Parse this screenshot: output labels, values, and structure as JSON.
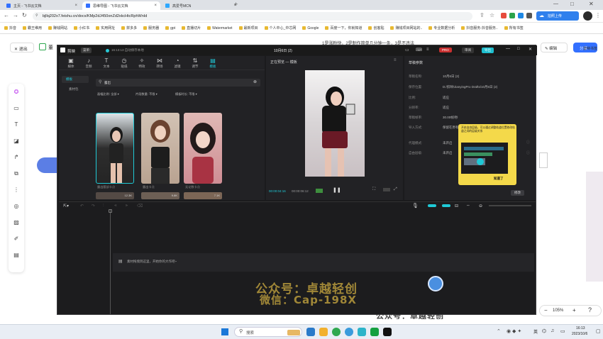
{
  "browser": {
    "tabs": [
      {
        "label": "主页 - 飞书云文档",
        "color": "#3370ff"
      },
      {
        "label": "思维导图 - 飞书云文档",
        "color": "#3370ff"
      },
      {
        "label": "高爱号MCN",
        "color": "#2fa8ff"
      }
    ],
    "url": "bjllq202x7.feishu.cn/docx/KMp2dJ450onZd2xkcHtcRphWnId",
    "bookmarks": [
      "抖音",
      "霸王维用",
      "赚钱网站",
      "小红书",
      "实用网址",
      "拼多多",
      "服务器",
      "gpt",
      "直播切片",
      "Watermarket",
      "最新项目",
      "个人中心_中芯网",
      "Google",
      "百度一下，你就知道",
      "创客贴",
      "赚钱项目网站的..",
      "专业数据分析",
      "抖音服务-抖音服务..",
      "所有书签"
    ]
  },
  "doc": {
    "exit_label": "退出",
    "doc_label": "董",
    "header_text": "1是涨粉快，2是制作简单几分钟一条，3是不违法",
    "edit_label": "编辑",
    "share_label": "分享",
    "zoom": "105%",
    "right_text": "雷特书签",
    "bottom_text": "公众号：卓越轻创"
  },
  "capcut": {
    "app_name": "剪映",
    "menu_label": "菜单",
    "autosave": "16:13:13 自动保存本地",
    "project_title": "10月6日 (2)",
    "pro_label": "PRO",
    "review_label": "审阅",
    "export_label": "导出",
    "toolbar": [
      {
        "label": "媒体",
        "glyph": "▣"
      },
      {
        "label": "音频",
        "glyph": "♪"
      },
      {
        "label": "文本",
        "glyph": "T"
      },
      {
        "label": "贴纸",
        "glyph": "◷"
      },
      {
        "label": "特效",
        "glyph": "✧"
      },
      {
        "label": "转场",
        "glyph": "⋈"
      },
      {
        "label": "滤镜",
        "glyph": "◔"
      },
      {
        "label": "调节",
        "glyph": "⇅"
      },
      {
        "label": "模板",
        "glyph": "▤"
      }
    ],
    "sidebar": [
      "模板",
      "素材包"
    ],
    "search_value": "露出",
    "filters": [
      "画幅比例: 全部",
      "片段数量: 不限",
      "模板时长: 不限"
    ],
    "templates": [
      {
        "caption": "露出腰部卡点",
        "stats": "12.3K"
      },
      {
        "caption": "露出卡点",
        "stats": "9.8K"
      },
      {
        "caption": "无论数卡点",
        "stats": "7.1K"
      }
    ],
    "preview": {
      "header": "正在预览 — 模板",
      "time_current": "00:00:04:16",
      "time_total": "00:00:06:12"
    },
    "draft": {
      "header": "草稿参数",
      "rows": [
        {
          "k": "草稿名称:",
          "v": "10月6日 (2)"
        },
        {
          "k": "保存位置:",
          "v": "D:/剪映/JianyingPro Drafts/10月6日 (2)"
        },
        {
          "k": "比例:",
          "v": "适应"
        },
        {
          "k": "分辨率:",
          "v": "适应"
        },
        {
          "k": "草稿帧率:",
          "v": "30.00帧/秒"
        },
        {
          "k": "导入方式:",
          "v": "保留在原有位置"
        },
        {
          "k": "代理模式:",
          "v": "未开启"
        },
        {
          "k": "自由层级:",
          "v": "未开启"
        }
      ],
      "edit_button": "修改",
      "tooltip_text": "开启自由层级，可以通过调整轨道位置修改轨道之间的层级关系",
      "tooltip_button": "知道了"
    },
    "timeline_hint": "素材拖拽到这里，开始你的大作吧~"
  },
  "watermark": {
    "line1": "公众号：卓越轻创",
    "line2": "微信：Cap-198X"
  },
  "taskbar": {
    "search_placeholder": "搜索",
    "language": "英",
    "time": "16:13",
    "date": "2023/10/6"
  }
}
